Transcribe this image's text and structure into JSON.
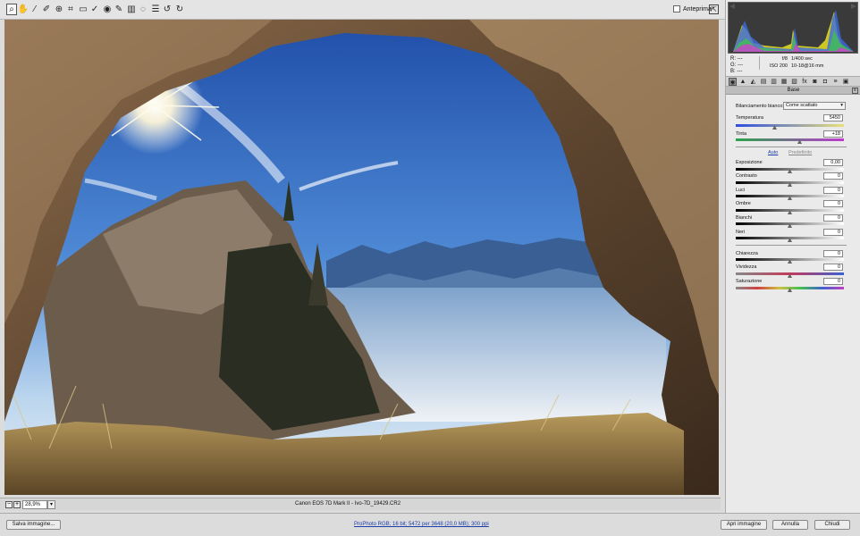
{
  "toolbar": {
    "tools": [
      "zoom-icon",
      "hand-icon",
      "white-balance-icon",
      "color-sampler-icon",
      "targeted-adjust-icon",
      "crop-icon",
      "straighten-icon",
      "spot-removal-icon",
      "red-eye-icon",
      "adjustment-brush-icon",
      "graduated-filter-icon",
      "radial-filter-icon",
      "preferences-icon",
      "rotate-left-icon",
      "rotate-right-icon"
    ],
    "tool_glyphs": [
      "⌕",
      "✋",
      "⁄",
      "✐",
      "⊕",
      "⌗",
      "▭",
      "✓",
      "◉",
      "✎",
      "▥",
      "◌",
      "☰",
      "↺",
      "↻"
    ],
    "preview_label": "Anteprima",
    "fullscreen_glyph": "⇱"
  },
  "status": {
    "zoom": "28,9%",
    "zoom_minus": "−",
    "zoom_plus": "+",
    "dropdown_arrow": "▾",
    "filename": "Canon EOS 7D Mark II  -  Ivo-7D_19429.CR2"
  },
  "histogram": {
    "r_label": "R:",
    "g_label": "G:",
    "b_label": "B:",
    "r": "---",
    "g": "---",
    "b": "---",
    "aperture": "f/8",
    "shutter": "1/400 sec",
    "iso": "ISO 200",
    "lens": "10-18@16 mm"
  },
  "panel": {
    "tab_glyphs": [
      "◉",
      "▲",
      "◭",
      "▤",
      "▥",
      "▦",
      "▧",
      "fx",
      "◙",
      "◘",
      "≡",
      "▣"
    ],
    "section_title": "Base",
    "section_menu_glyph": "≡",
    "wb_label": "Bilanciamento bianco:",
    "wb_value": "Come scattato",
    "wb_arrow": "▾",
    "auto": "Auto",
    "default": "Predefinito",
    "sliders": {
      "temperatura": {
        "label": "Temperatura",
        "value": "5450"
      },
      "tinta": {
        "label": "Tinta",
        "value": "+18"
      },
      "esposizione": {
        "label": "Esposizione",
        "value": "0,00"
      },
      "contrasto": {
        "label": "Contrasto",
        "value": "0"
      },
      "luci": {
        "label": "Luci",
        "value": "0"
      },
      "ombre": {
        "label": "Ombre",
        "value": "0"
      },
      "bianchi": {
        "label": "Bianchi",
        "value": "0"
      },
      "neri": {
        "label": "Neri",
        "value": "0"
      },
      "chiarezza": {
        "label": "Chiarezza",
        "value": "0"
      },
      "vividezza": {
        "label": "Vividezza",
        "value": "0"
      },
      "saturazione": {
        "label": "Saturazione",
        "value": "0"
      }
    }
  },
  "footer": {
    "save": "Salva immagine...",
    "workflow": "ProPhoto RGB; 16 bit; 5472 per 3648 (20,0 MB); 300 ppi",
    "open": "Apri immagine",
    "cancel": "Annulla",
    "done": "Chiudi"
  }
}
